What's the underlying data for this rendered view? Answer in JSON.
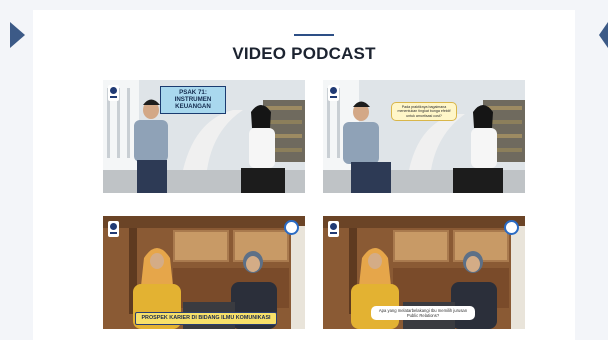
{
  "section": {
    "title": "VIDEO PODCAST"
  },
  "videos": [
    {
      "caption": "PSAK 71: INSTRUMEN KEUANGAN"
    },
    {
      "caption": "Pada praktiknya bagaimana menentukan tingkat bunga efektif untuk amortisasi cost?"
    },
    {
      "caption": "PROSPEK KARIER DI BIDANG ILMU KOMUNIKASI"
    },
    {
      "caption": "Apa yang melatarbelakangi Ibu memilih jurusan Public Relations?"
    }
  ],
  "colors": {
    "accent": "#3c5a87",
    "title": "#1c2330",
    "caption_blue": "#a9d8ee",
    "banner_yellow": "#f7e06a"
  },
  "icons": {
    "prev": "triangle-left-icon",
    "next": "triangle-right-icon",
    "university_logo": "ut-logo-icon",
    "ministry_seal": "tut-wuri-seal-icon"
  }
}
